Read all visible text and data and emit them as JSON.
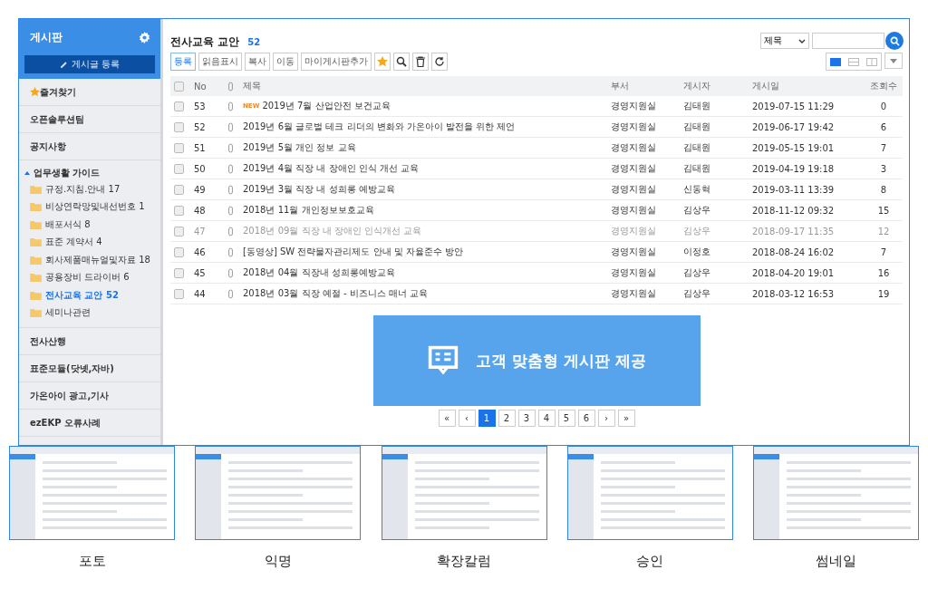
{
  "sidebar": {
    "title": "게시판",
    "new_post_button": "게시글 등록",
    "items": [
      {
        "kind": "favorite",
        "label": "즐겨찾기"
      },
      {
        "kind": "link",
        "label": "오픈솔루션팀"
      },
      {
        "kind": "link",
        "label": "공지사항"
      },
      {
        "kind": "group",
        "label": "업무생활 가이드",
        "expanded": true,
        "children": [
          {
            "label": "규정.지침.안내",
            "count": "17",
            "selected": false
          },
          {
            "label": "비상연락망및내선번호",
            "count": "1",
            "selected": false
          },
          {
            "label": "배포서식",
            "count": "8",
            "selected": false
          },
          {
            "label": "표준 계약서",
            "count": "4",
            "selected": false
          },
          {
            "label": "회사제품매뉴얼및자료",
            "count": "18",
            "selected": false
          },
          {
            "label": "공용장비 드라이버",
            "count": "6",
            "selected": false
          },
          {
            "label": "전사교육 교안",
            "count": "52",
            "selected": true
          },
          {
            "label": "세미나관련",
            "selected": false
          }
        ]
      },
      {
        "kind": "link",
        "label": "전사산행"
      },
      {
        "kind": "link",
        "label": "표준모듈(닷넷,자바)"
      },
      {
        "kind": "link",
        "label": "가온아이 광고,기사"
      },
      {
        "kind": "link",
        "label": "ezEKP 오류사례"
      }
    ]
  },
  "board": {
    "title": "전사교육 교안",
    "count": "52"
  },
  "search": {
    "field": "제목"
  },
  "toolbar": [
    {
      "kind": "text",
      "label": "등록",
      "primary": true
    },
    {
      "kind": "text",
      "label": "읽음표시",
      "primary": false
    },
    {
      "kind": "text",
      "label": "복사",
      "primary": false
    },
    {
      "kind": "text",
      "label": "이동",
      "primary": false
    },
    {
      "kind": "text",
      "label": "마이게시판추가",
      "primary": false
    },
    {
      "kind": "star"
    },
    {
      "kind": "search"
    },
    {
      "kind": "delete"
    },
    {
      "kind": "refresh"
    }
  ],
  "view_modes": [
    {
      "kind": "list",
      "selected": true
    },
    {
      "kind": "horizontal",
      "selected": false
    },
    {
      "kind": "vertical",
      "selected": false
    }
  ],
  "table": {
    "select_all": {
      "checked": false
    },
    "columns": [
      "No",
      "제목",
      "부서",
      "게시자",
      "게시일",
      "조회수"
    ],
    "rows": [
      {
        "no": "53",
        "badge": "NEW",
        "title": "2019년 7월 산업안전 보건교육",
        "dept": "경영지원실",
        "author": "김태원",
        "date": "2019-07-15 11:29",
        "views": "0",
        "read": false,
        "checked": false
      },
      {
        "no": "52",
        "title": "2019년 6월 글로벌 테크 리더의 변화와 가온아이 발전을 위한 제언",
        "dept": "경영지원실",
        "author": "김태원",
        "date": "2019-06-17 19:42",
        "views": "6",
        "read": false,
        "checked": false
      },
      {
        "no": "51",
        "title": "2019년 5월 개인 정보 교육",
        "dept": "경영지원실",
        "author": "김태원",
        "date": "2019-05-15 19:01",
        "views": "7",
        "read": false,
        "checked": false
      },
      {
        "no": "50",
        "title": "2019년 4월 직장 내 장애인 인식 개선 교육",
        "dept": "경영지원실",
        "author": "김태원",
        "date": "2019-04-19 19:18",
        "views": "3",
        "read": false,
        "checked": false
      },
      {
        "no": "49",
        "title": "2019년 3월 직장 내 성희롱 예방교육",
        "dept": "경영지원실",
        "author": "신동혁",
        "date": "2019-03-11 13:39",
        "views": "8",
        "read": false,
        "checked": false
      },
      {
        "no": "48",
        "title": "2018년 11월 개인정보보호교육",
        "dept": "경영지원실",
        "author": "김상우",
        "date": "2018-11-12 09:32",
        "views": "15",
        "read": false,
        "checked": false
      },
      {
        "no": "47",
        "title": "2018년 09월 직장 내 장애인 인식개선 교육",
        "dept": "경영지원실",
        "author": "김상우",
        "date": "2018-09-17 11:35",
        "views": "12",
        "read": true,
        "checked": false
      },
      {
        "no": "46",
        "title": "[동영상] SW 전략물자관리제도 안내 및 자율준수 방안",
        "dept": "경영지원실",
        "author": "이정호",
        "date": "2018-08-24 16:02",
        "views": "7",
        "read": false,
        "checked": false
      },
      {
        "no": "45",
        "title": "2018년 04월 직장내 성희롱예방교육",
        "dept": "경영지원실",
        "author": "김상우",
        "date": "2018-04-20 19:01",
        "views": "16",
        "read": false,
        "checked": false
      },
      {
        "no": "44",
        "title": "2018년 03월 직장 예절 - 비즈니스 매너 교육",
        "dept": "경영지원실",
        "author": "김상우",
        "date": "2018-03-12 16:53",
        "views": "19",
        "read": false,
        "checked": false
      }
    ]
  },
  "pagination": {
    "first": "«",
    "prev": "‹",
    "next": "›",
    "last": "»",
    "pages": [
      {
        "label": "1",
        "selected": true
      },
      {
        "label": "2",
        "selected": false
      },
      {
        "label": "3",
        "selected": false
      },
      {
        "label": "4",
        "selected": false
      },
      {
        "label": "5",
        "selected": false
      },
      {
        "label": "6",
        "selected": false
      }
    ]
  },
  "banner": {
    "text": "고객 맞춤형 게시판 제공"
  },
  "variants": [
    {
      "label": "포토"
    },
    {
      "label": "익명"
    },
    {
      "label": "확장칼럼"
    },
    {
      "label": "승인"
    },
    {
      "label": "썸네일"
    }
  ]
}
